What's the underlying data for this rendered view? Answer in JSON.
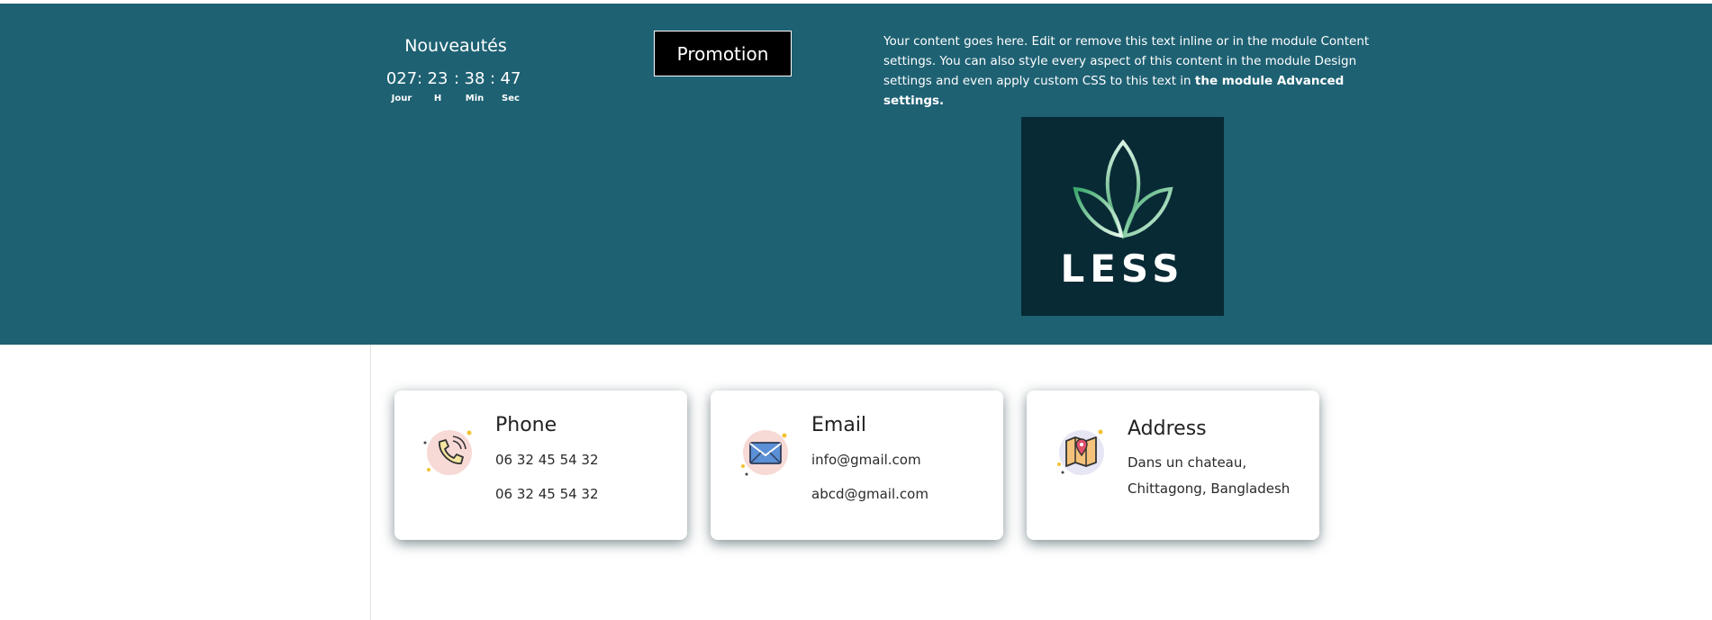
{
  "countdown": {
    "title": "Nouveautés",
    "days": "027",
    "hours": "23",
    "minutes": "38",
    "seconds": "47",
    "days_label": "Jour",
    "hours_label": "H",
    "minutes_label": "Min",
    "seconds_label": "Sec",
    "separator": ":"
  },
  "promo": {
    "label": "Promotion"
  },
  "content": {
    "text": "Your content goes here. Edit or remove this text inline or in the module Content settings. You can also style every aspect of this content in the module Design settings and even apply custom CSS to this text in ",
    "bold_text": "the module Advanced settings."
  },
  "logo": {
    "wordmark": "LESS"
  },
  "cards": [
    {
      "title": "Phone",
      "line1": "06 32 45 54 32",
      "line2": "06 32 45 54 32",
      "icon": "phone-icon"
    },
    {
      "title": "Email",
      "line1": "info@gmail.com",
      "line2": "abcd@gmail.com",
      "icon": "email-icon"
    },
    {
      "title": "Address",
      "line1": "Dans un chateau,",
      "line2": "Chittagong, Bangladesh",
      "icon": "map-icon"
    }
  ],
  "colors": {
    "band": "#1e6173",
    "logo_bg": "#082a35",
    "button_bg": "#000000"
  }
}
